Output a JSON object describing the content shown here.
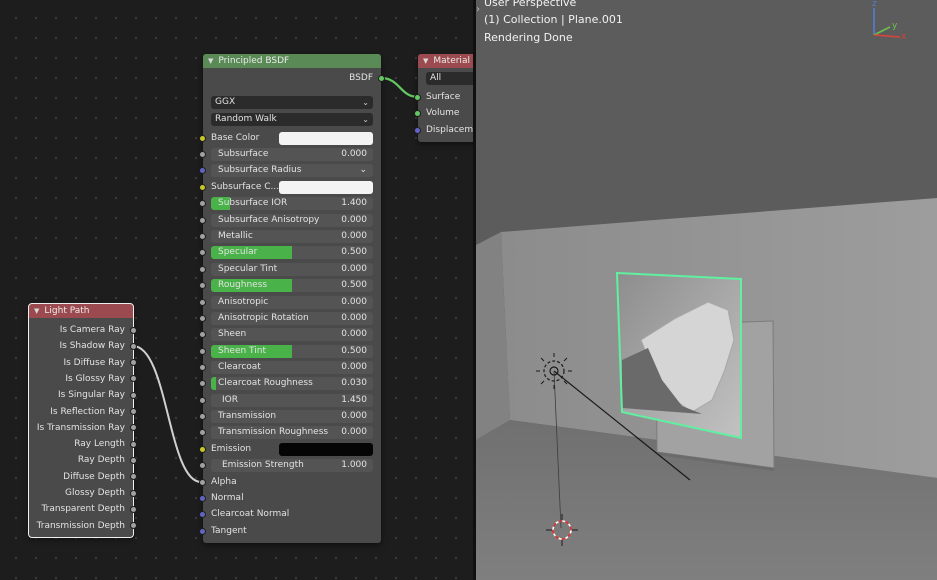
{
  "principled_bsdf": {
    "title": "Principled BSDF",
    "output_label": "BSDF",
    "distribution": "GGX",
    "subsurface_method": "Random Walk",
    "base_color_label": "Base Color",
    "base_color_value": "#f4f4f4",
    "subsurface": {
      "label": "Subsurface",
      "value": "0.000",
      "fill": 0
    },
    "subsurface_radius_label": "Subsurface Radius",
    "subsurface_color_label": "Subsurface C...",
    "subsurface_color_value": "#f4f4f4",
    "subsurface_ior": {
      "label": "Subsurface IOR",
      "value": "1.400",
      "fill": 0.12
    },
    "subsurface_anisotropy": {
      "label": "Subsurface Anisotropy",
      "value": "0.000",
      "fill": 0
    },
    "metallic": {
      "label": "Metallic",
      "value": "0.000",
      "fill": 0
    },
    "specular": {
      "label": "Specular",
      "value": "0.500",
      "fill": 0.5
    },
    "specular_tint": {
      "label": "Specular Tint",
      "value": "0.000",
      "fill": 0
    },
    "roughness": {
      "label": "Roughness",
      "value": "0.500",
      "fill": 0.5
    },
    "anisotropic": {
      "label": "Anisotropic",
      "value": "0.000",
      "fill": 0
    },
    "anisotropic_rotation": {
      "label": "Anisotropic Rotation",
      "value": "0.000",
      "fill": 0
    },
    "sheen": {
      "label": "Sheen",
      "value": "0.000",
      "fill": 0
    },
    "sheen_tint": {
      "label": "Sheen Tint",
      "value": "0.500",
      "fill": 0.5
    },
    "clearcoat": {
      "label": "Clearcoat",
      "value": "0.000",
      "fill": 0
    },
    "clearcoat_roughness": {
      "label": "Clearcoat Roughness",
      "value": "0.030",
      "fill": 0.03
    },
    "ior": {
      "label": "IOR",
      "value": "1.450",
      "fill": 0
    },
    "transmission": {
      "label": "Transmission",
      "value": "0.000",
      "fill": 0
    },
    "transmission_roughness": {
      "label": "Transmission Roughness",
      "value": "0.000",
      "fill": 0
    },
    "emission_label": "Emission",
    "emission_value": "#050505",
    "emission_strength": {
      "label": "Emission Strength",
      "value": "1.000",
      "fill": 0
    },
    "alpha_label": "Alpha",
    "normal_label": "Normal",
    "clearcoat_normal_label": "Clearcoat Normal",
    "tangent_label": "Tangent"
  },
  "material_output": {
    "title": "Material O",
    "target": "All",
    "surface_label": "Surface",
    "volume_label": "Volume",
    "displacement_label": "Displaceme"
  },
  "light_path": {
    "title": "Light Path",
    "outputs": [
      "Is Camera Ray",
      "Is Shadow Ray",
      "Is Diffuse Ray",
      "Is Glossy Ray",
      "Is Singular Ray",
      "Is Reflection Ray",
      "Is Transmission Ray",
      "Ray Length",
      "Ray Depth",
      "Diffuse Depth",
      "Glossy Depth",
      "Transparent Depth",
      "Transmission Depth"
    ]
  },
  "viewport": {
    "view_name": "User Perspective",
    "collection": "(1) Collection | Plane.001",
    "status": "Rendering Done",
    "gizmo_axes": {
      "z": "z",
      "y": "y",
      "x": "x"
    }
  },
  "colors": {
    "accent_green": "#49b248",
    "selection_outline": "#5ff0a0",
    "node_header_shader": "#5a8a56",
    "node_header_output": "#9b4b4f"
  }
}
